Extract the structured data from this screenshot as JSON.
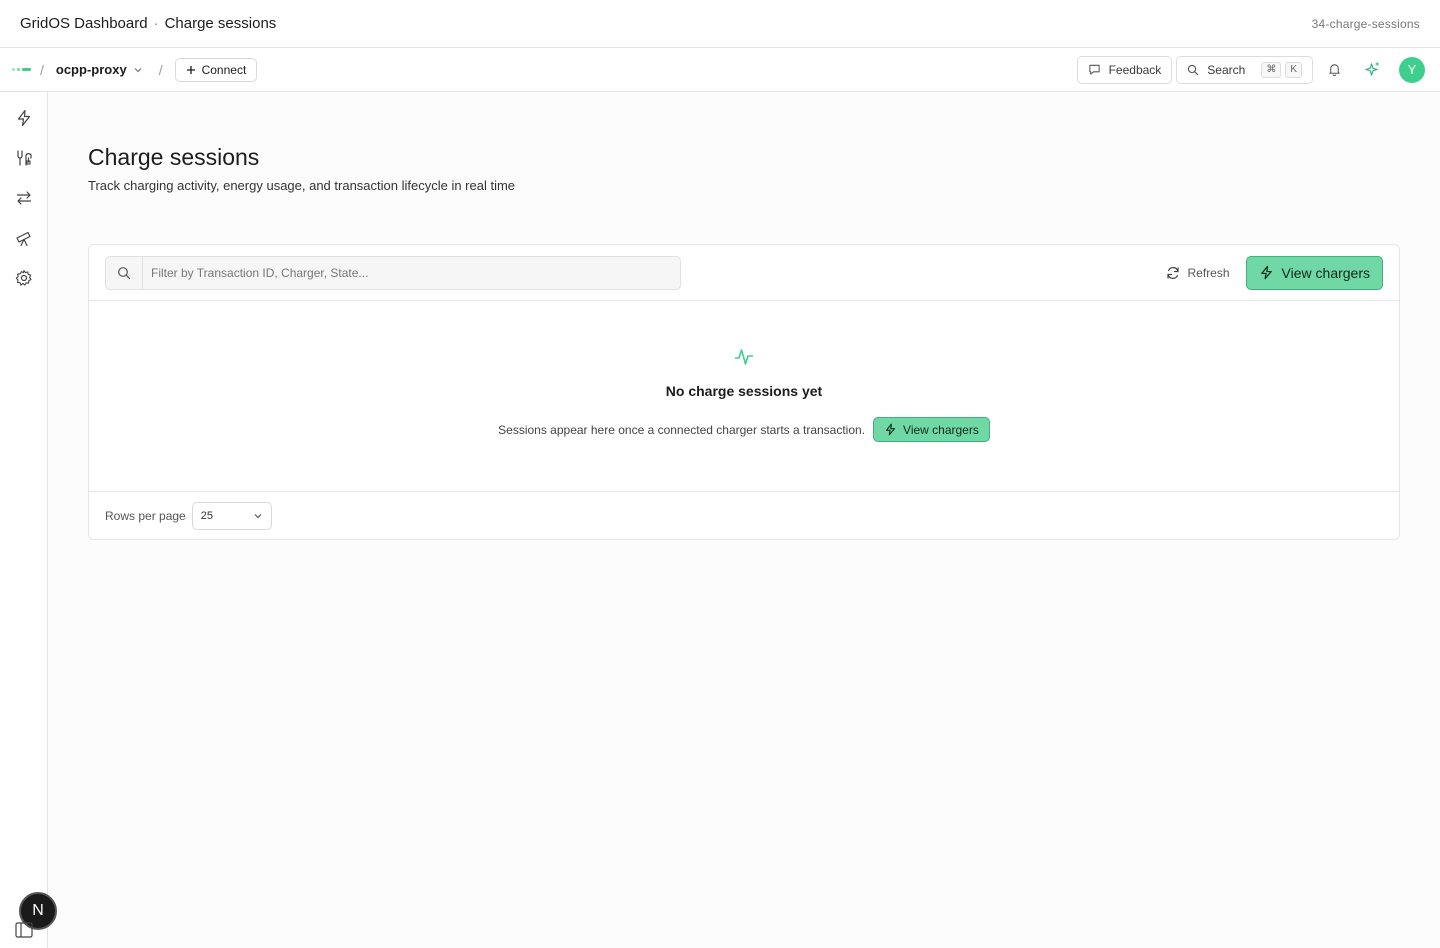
{
  "titlebar": {
    "app": "GridOS Dashboard",
    "dot": "·",
    "page": "Charge sessions",
    "slug": "34-charge-sessions"
  },
  "topnav": {
    "separator": "/",
    "project": "ocpp-proxy",
    "connect_label": "Connect",
    "feedback_label": "Feedback",
    "search_label": "Search",
    "search_kbd": [
      "⌘",
      "K"
    ],
    "avatar_initial": "Y"
  },
  "sidebar": {
    "items": [
      {
        "icon": "bolt-icon"
      },
      {
        "icon": "plug-icon"
      },
      {
        "icon": "transfer-icon"
      },
      {
        "icon": "telescope-icon"
      },
      {
        "icon": "gear-icon"
      }
    ],
    "badge": "N"
  },
  "page": {
    "title": "Charge sessions",
    "subtitle": "Track charging activity, energy usage, and transaction lifecycle in real time"
  },
  "toolbar": {
    "filter_placeholder": "Filter by Transaction ID, Charger, State...",
    "refresh_label": "Refresh",
    "view_chargers_label": "View chargers"
  },
  "empty_state": {
    "title": "No charge sessions yet",
    "message": "Sessions appear here once a connected charger starts a transaction.",
    "button_label": "View chargers"
  },
  "footer": {
    "rows_label": "Rows per page",
    "rows_value": "25"
  },
  "colors": {
    "accent": "#3ecf8e",
    "button_green": "#6fd8a5"
  }
}
